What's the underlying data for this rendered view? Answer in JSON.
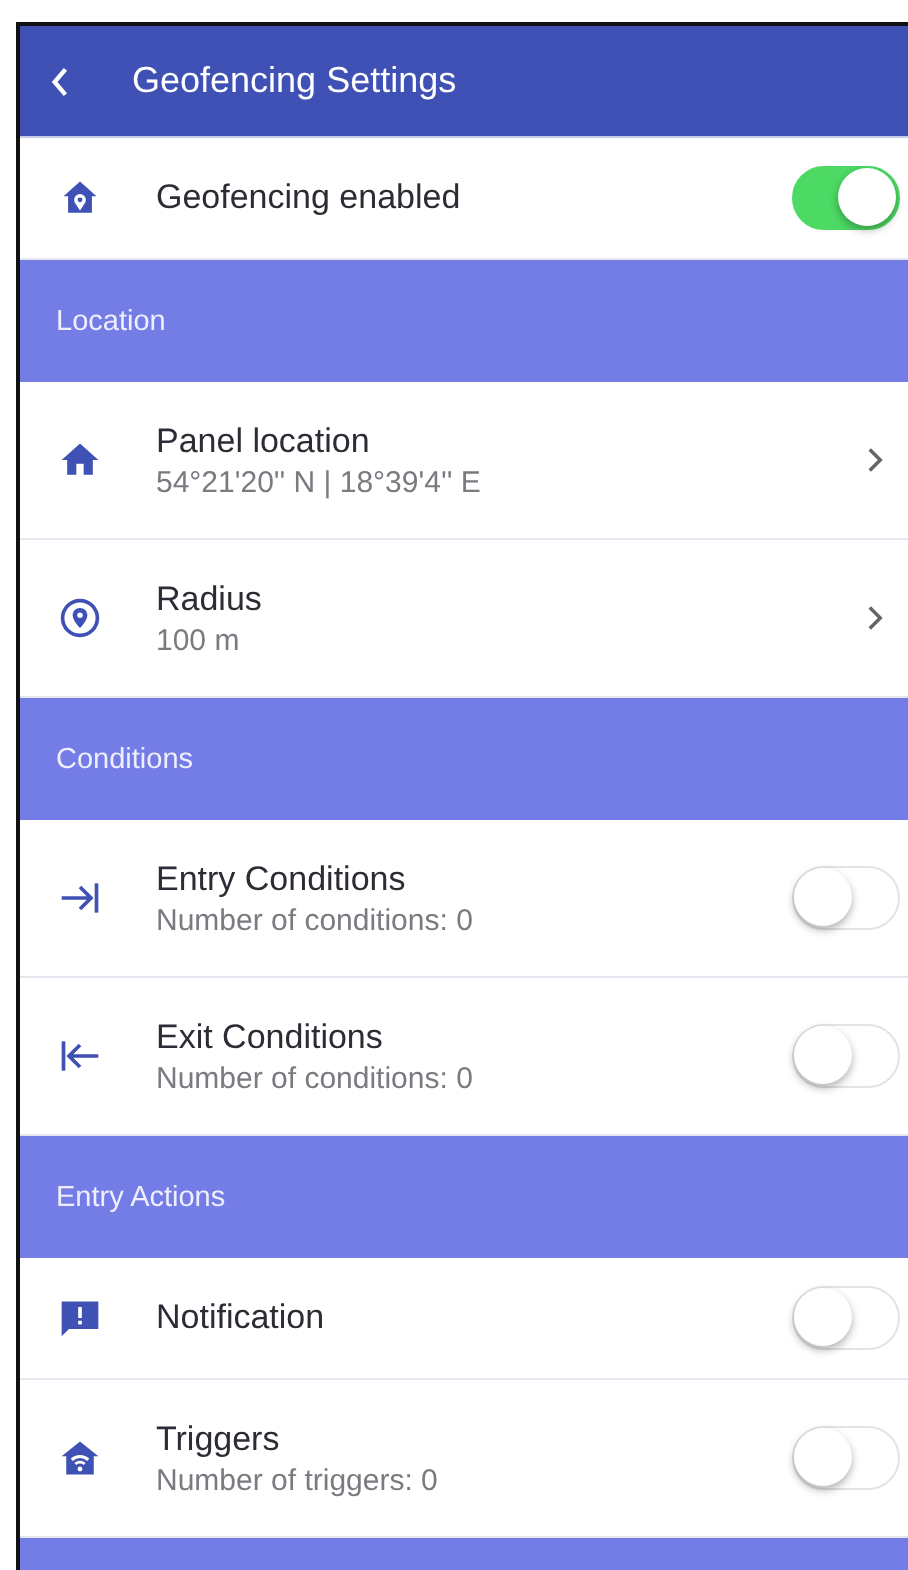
{
  "header": {
    "title": "Geofencing Settings"
  },
  "top_item": {
    "kind": "toggle",
    "label": "Geofencing enabled",
    "on": true
  },
  "sections": [
    {
      "title": "Location",
      "items": [
        {
          "kind": "link",
          "label": "Panel location",
          "subtitle": "54°21'20'' N | 18°39'4'' E"
        },
        {
          "kind": "link",
          "label": "Radius",
          "subtitle": "100 m"
        }
      ]
    },
    {
      "title": "Conditions",
      "items": [
        {
          "kind": "toggle",
          "label": "Entry Conditions",
          "subtitle": "Number of conditions: 0",
          "on": false
        },
        {
          "kind": "toggle",
          "label": "Exit Conditions",
          "subtitle": "Number of conditions: 0",
          "on": false
        }
      ]
    },
    {
      "title": "Entry Actions",
      "items": [
        {
          "kind": "toggle",
          "label": "Notification",
          "on": false
        },
        {
          "kind": "toggle",
          "label": "Triggers",
          "subtitle": "Number of triggers: 0",
          "on": false
        }
      ]
    }
  ]
}
